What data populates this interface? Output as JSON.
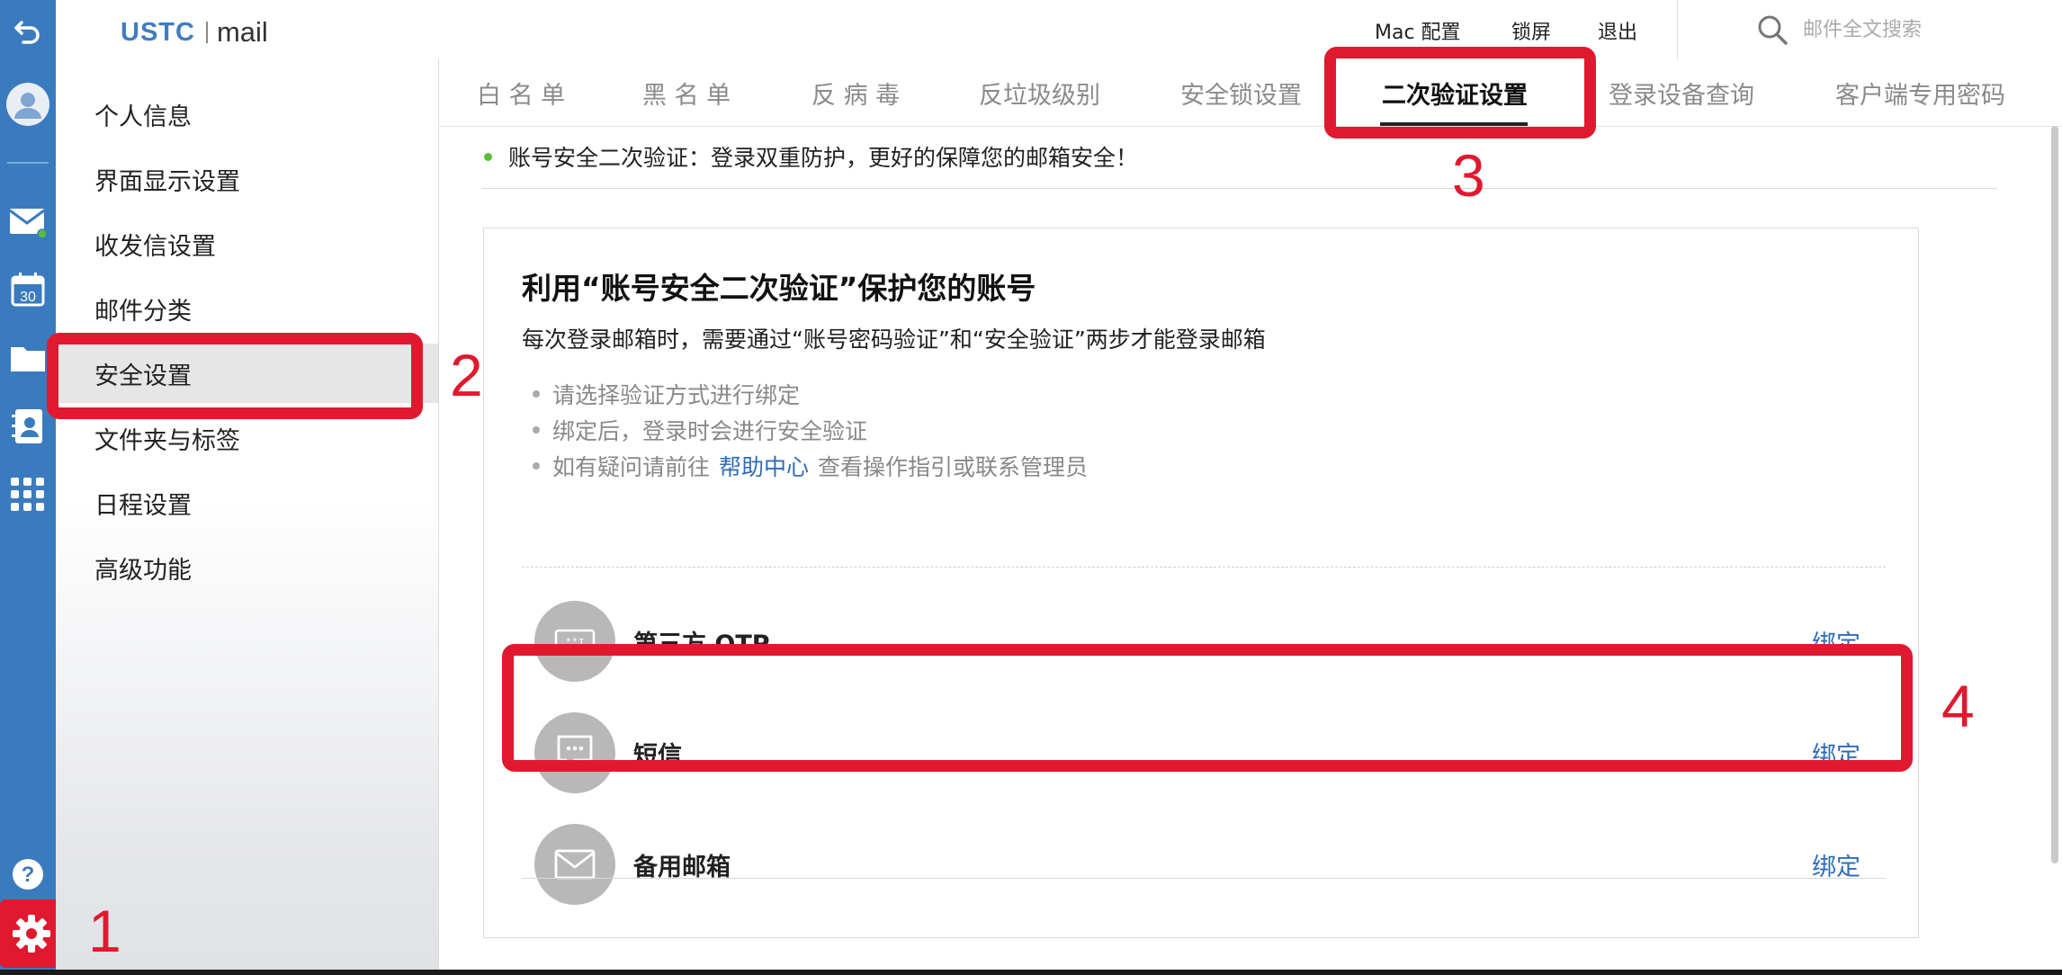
{
  "app": {
    "logo_ustc": "USTC",
    "logo_mail": "mail"
  },
  "header": {
    "links": [
      "Mac 配置",
      "锁屏",
      "退出"
    ],
    "search_placeholder": "邮件全文搜索"
  },
  "rail": {
    "icons": [
      "back-icon",
      "avatar-icon",
      "mail-icon",
      "calendar-icon",
      "folder-icon",
      "contacts-icon",
      "apps-grid-icon",
      "help-icon",
      "gear-icon"
    ],
    "calendar_day": "30",
    "colors": {
      "rail": "#3a7bbf",
      "unread_dot": "#5bbf36"
    }
  },
  "sidebar": {
    "items": [
      {
        "label": "个人信息"
      },
      {
        "label": "界面显示设置"
      },
      {
        "label": "收发信设置"
      },
      {
        "label": "邮件分类"
      },
      {
        "label": "安全设置",
        "active": true
      },
      {
        "label": "文件夹与标签"
      },
      {
        "label": "日程设置"
      },
      {
        "label": "高级功能"
      }
    ]
  },
  "tabs": [
    {
      "label": "白 名 单"
    },
    {
      "label": "黑 名 单"
    },
    {
      "label": "反 病 毒"
    },
    {
      "label": "反垃圾级别"
    },
    {
      "label": "安全锁设置"
    },
    {
      "label": "二次验证设置",
      "active": true
    },
    {
      "label": "登录设备查询"
    },
    {
      "label": "客户端专用密码"
    }
  ],
  "notice": "账号安全二次验证：登录双重防护，更好的保障您的邮箱安全！",
  "card": {
    "title": "利用“账号安全二次验证”保护您的账号",
    "desc": "每次登录邮箱时，需要通过“账号密码验证”和“安全验证”两步才能登录邮箱",
    "bullets": {
      "b1": "请选择验证方式进行绑定",
      "b2": "绑定后，登录时会进行安全验证",
      "b3_prefix": "如有疑问请前往",
      "b3_link": "帮助中心",
      "b3_suffix": "查看操作指引或联系管理员"
    },
    "options": [
      {
        "label": "第三方 OTP",
        "icon": "otp-password-icon",
        "action": "绑定"
      },
      {
        "label": "短信",
        "icon": "sms-chat-icon",
        "action": "绑定"
      },
      {
        "label": "备用邮箱",
        "icon": "envelope-icon",
        "action": "绑定"
      }
    ]
  },
  "annotations": [
    "1",
    "2",
    "3",
    "4"
  ],
  "colors": {
    "accent_link": "#2f6db5",
    "annotation_red": "#e0192e",
    "brand_blue": "#3f7dc2"
  }
}
